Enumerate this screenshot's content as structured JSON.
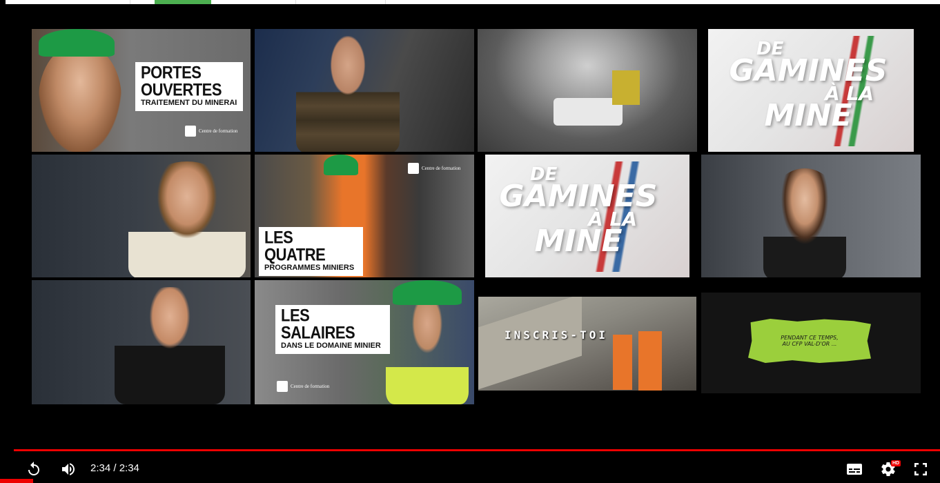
{
  "player": {
    "time_display": "2:34 / 2:34",
    "progress_fraction": 1.0,
    "hd_badge": "HD",
    "accent_color": "#ff0000"
  },
  "tiles": [
    {
      "title_big": "PORTES OUVERTES",
      "title_small": "TRAITEMENT DU MINERAI",
      "logo_text": "Centre de formation"
    },
    {
      "title_big": "LES QUATRE",
      "title_small": "PROGRAMMES MINIERS",
      "logo_text": "Centre de formation"
    },
    {
      "title_big": "LES SALAIRES",
      "title_small": "DANS LE DOMAINE MINIER",
      "logo_text": "Centre de formation"
    },
    {
      "gamines_line1": "DE",
      "gamines_line2": "GAMINES",
      "gamines_line3": "À LA",
      "gamines_line4": "MINE"
    },
    {
      "inscris": "INSCRIS-TOI"
    },
    {
      "note_line1": "PENDANT CE TEMPS,",
      "note_line2": "AU CFP VAL-D'OR ..."
    }
  ],
  "icons": {
    "replay": "replay-icon",
    "volume": "volume-icon",
    "subtitles": "subtitles-icon",
    "settings": "settings-icon",
    "fullscreen": "fullscreen-icon"
  }
}
